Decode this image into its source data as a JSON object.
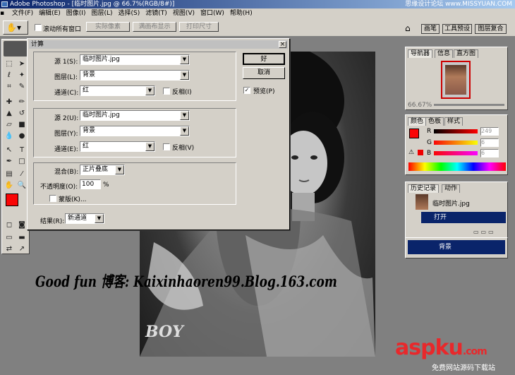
{
  "title": {
    "text": "Adobe Photoshop - [临时图片.jpg @ 66.7%(RGB/8#)]",
    "watermark": "思缘设计论坛 www.MISSYUAN.COM"
  },
  "menu": [
    "文件(F)",
    "编辑(E)",
    "图像(I)",
    "图层(L)",
    "选择(S)",
    "滤镜(T)",
    "视图(V)",
    "窗口(W)",
    "帮助(H)"
  ],
  "options": {
    "scroll_all": "滚动所有窗口",
    "actual_pixels": "实际像素",
    "fit_screen": "满画布显示",
    "print_size": "打印尺寸",
    "tabs": [
      "画笔",
      "工具预设",
      "图层复合"
    ]
  },
  "dialog": {
    "title": "计算",
    "source1": {
      "label": "源 1(S):",
      "file": "临时图片.jpg",
      "layer_label": "图层(L):",
      "layer": "背景",
      "channel_label": "通道(C):",
      "channel": "红",
      "invert": "反相(I)"
    },
    "source2": {
      "label": "源 2(U):",
      "file": "临时图片.jpg",
      "layer_label": "图层(Y):",
      "layer": "背景",
      "channel_label": "通道(E):",
      "channel": "红",
      "invert": "反相(V)"
    },
    "blend_label": "混合(B):",
    "blend": "正片叠底",
    "opacity_label": "不透明度(O):",
    "opacity": "100",
    "percent": "%",
    "mask": "蒙版(K)...",
    "result_label": "结果(R):",
    "result": "新通道",
    "ok": "好",
    "cancel": "取消",
    "preview": "预览(P)"
  },
  "navigator": {
    "tabs": [
      "导航器",
      "信息",
      "直方图"
    ],
    "zoom": "66.67%"
  },
  "color": {
    "tabs": [
      "颜色",
      "色板",
      "样式"
    ],
    "r_label": "R",
    "g_label": "G",
    "b_label": "B",
    "r": "249",
    "g": "6",
    "b": "6",
    "fg": "#f90606"
  },
  "history": {
    "tabs": [
      "历史记录",
      "动作"
    ],
    "snapshot": "临时图片.jpg",
    "step": "打开"
  },
  "layers": {
    "name": "背景"
  },
  "overlay": {
    "blog": "Good fun 博客: Kaixinhaoren99.Blog.163.com",
    "boy": "BOY",
    "site": "aspku",
    "site_suffix": ".com",
    "site_sub": "免费网站源码下载站"
  }
}
